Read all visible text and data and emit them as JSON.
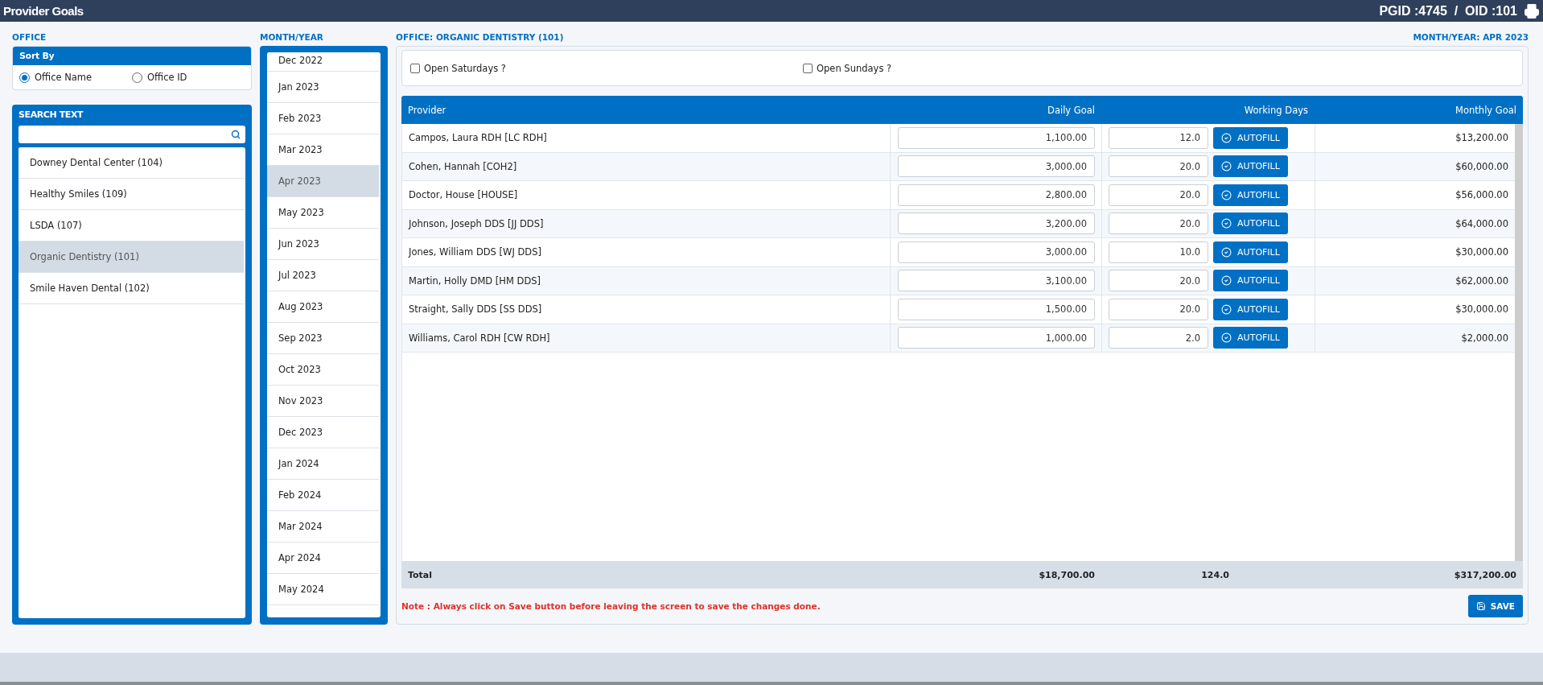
{
  "header": {
    "title": "Provider Goals",
    "ids": "PGID :4745  /  OID :101"
  },
  "office_panel": {
    "label": "OFFICE",
    "sort_by": {
      "title": "Sort By",
      "options": [
        {
          "label": "Office Name",
          "selected": true
        },
        {
          "label": "Office ID",
          "selected": false
        }
      ]
    },
    "search": {
      "title": "SEARCH TEXT"
    },
    "offices": [
      {
        "label": "Downey Dental Center (104)",
        "selected": false
      },
      {
        "label": "Healthy Smiles (109)",
        "selected": false
      },
      {
        "label": "LSDA (107)",
        "selected": false
      },
      {
        "label": "Organic Dentistry (101)",
        "selected": true
      },
      {
        "label": "Smile Haven Dental (102)",
        "selected": false
      }
    ]
  },
  "month_panel": {
    "label": "MONTH/YEAR",
    "months": [
      {
        "label": "Dec 2022",
        "selected": false
      },
      {
        "label": "Jan 2023",
        "selected": false
      },
      {
        "label": "Feb 2023",
        "selected": false
      },
      {
        "label": "Mar 2023",
        "selected": false
      },
      {
        "label": "Apr 2023",
        "selected": true
      },
      {
        "label": "May 2023",
        "selected": false
      },
      {
        "label": "Jun 2023",
        "selected": false
      },
      {
        "label": "Jul 2023",
        "selected": false
      },
      {
        "label": "Aug 2023",
        "selected": false
      },
      {
        "label": "Sep 2023",
        "selected": false
      },
      {
        "label": "Oct 2023",
        "selected": false
      },
      {
        "label": "Nov 2023",
        "selected": false
      },
      {
        "label": "Dec 2023",
        "selected": false
      },
      {
        "label": "Jan 2024",
        "selected": false
      },
      {
        "label": "Feb 2024",
        "selected": false
      },
      {
        "label": "Mar 2024",
        "selected": false
      },
      {
        "label": "Apr 2024",
        "selected": false
      },
      {
        "label": "May 2024",
        "selected": false
      }
    ]
  },
  "main": {
    "office_label": "OFFICE: ORGANIC DENTISTRY (101)",
    "month_label": "MONTH/YEAR: APR 2023",
    "options": [
      {
        "label": "Open Saturdays ?",
        "checked": false
      },
      {
        "label": "Open Sundays ?",
        "checked": false
      }
    ],
    "table": {
      "columns": [
        "Provider",
        "Daily Goal",
        "Working Days",
        "Monthly Goal"
      ],
      "rows": [
        {
          "provider": "Campos, Laura RDH [LC RDH]",
          "daily_goal": "1,100.00",
          "working_days": "12.0",
          "autofill": "AUTOFILL",
          "monthly_goal": "$13,200.00"
        },
        {
          "provider": "Cohen, Hannah [COH2]",
          "daily_goal": "3,000.00",
          "working_days": "20.0",
          "autofill": "AUTOFILL",
          "monthly_goal": "$60,000.00"
        },
        {
          "provider": "Doctor, House [HOUSE]",
          "daily_goal": "2,800.00",
          "working_days": "20.0",
          "autofill": "AUTOFILL",
          "monthly_goal": "$56,000.00"
        },
        {
          "provider": "Johnson, Joseph DDS [JJ DDS]",
          "daily_goal": "3,200.00",
          "working_days": "20.0",
          "autofill": "AUTOFILL",
          "monthly_goal": "$64,000.00"
        },
        {
          "provider": "Jones, William DDS [WJ DDS]",
          "daily_goal": "3,000.00",
          "working_days": "10.0",
          "autofill": "AUTOFILL",
          "monthly_goal": "$30,000.00"
        },
        {
          "provider": "Martin, Holly DMD [HM DDS]",
          "daily_goal": "3,100.00",
          "working_days": "20.0",
          "autofill": "AUTOFILL",
          "monthly_goal": "$62,000.00"
        },
        {
          "provider": "Straight, Sally DDS [SS DDS]",
          "daily_goal": "1,500.00",
          "working_days": "20.0",
          "autofill": "AUTOFILL",
          "monthly_goal": "$30,000.00"
        },
        {
          "provider": "Williams, Carol RDH [CW RDH]",
          "daily_goal": "1,000.00",
          "working_days": "2.0",
          "autofill": "AUTOFILL",
          "monthly_goal": "$2,000.00"
        }
      ],
      "total": {
        "label": "Total",
        "daily_goal": "$18,700.00",
        "working_days": "124.0",
        "monthly_goal": "$317,200.00"
      }
    },
    "note": "Note : Always click on Save button before leaving the screen to save the changes done.",
    "save_button": "SAVE"
  }
}
